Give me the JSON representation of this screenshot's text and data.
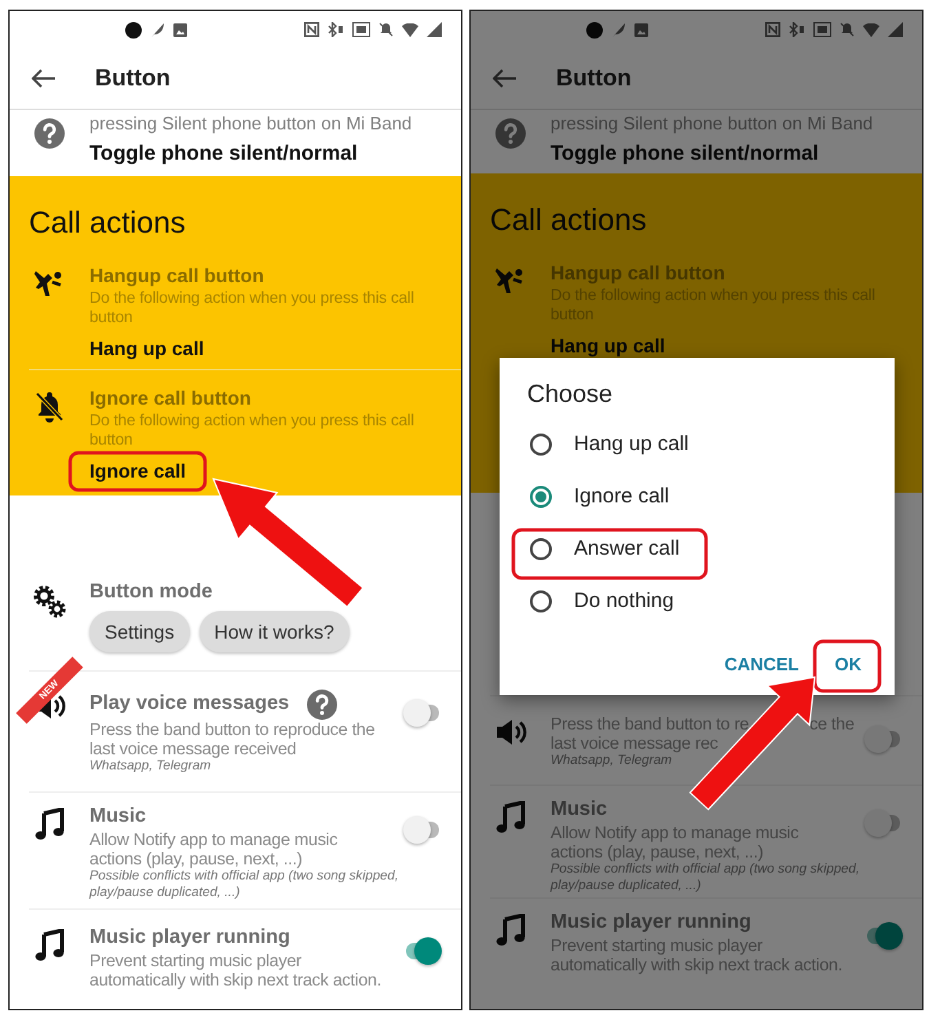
{
  "screens": [
    {
      "dimmed": false,
      "title": "Button",
      "items": [
        {
          "kind": "help_value",
          "description": "pressing Silent phone button on Mi Band",
          "value": "Toggle phone silent/normal"
        },
        {
          "kind": "section",
          "highlighted": true,
          "title": "Call actions",
          "items": [
            {
              "kind": "hangup",
              "title": "Hangup call button",
              "description": "Do the following action when you press this call button",
              "value": "Hang up call"
            },
            {
              "kind": "ignore",
              "title": "Ignore call button",
              "description": "Do the following action when you press this call button",
              "value": "Ignore call"
            }
          ]
        },
        {
          "kind": "mode",
          "title": "Button mode",
          "buttons": [
            "Settings",
            "How it works?"
          ]
        },
        {
          "kind": "voice",
          "badge": "NEW",
          "title": "Play voice messages",
          "description": "Press the band button to reproduce the last voice message received",
          "note": "Whatsapp, Telegram",
          "on": false
        },
        {
          "kind": "music",
          "title": "Music",
          "description": "Allow Notify app to manage music actions (play, pause, next, ...)",
          "note": "Possible conflicts with official app (two song skipped, play/pause duplicated, ...)",
          "on": false
        },
        {
          "kind": "music",
          "title": "Music player running",
          "description": "Prevent starting music player automatically with skip next track action.",
          "on": true
        }
      ]
    },
    {
      "dimmed": true,
      "title": "Button",
      "items": [
        {
          "kind": "help_value",
          "description": "pressing Silent phone button on Mi Band",
          "value": "Toggle phone silent/normal"
        },
        {
          "kind": "section",
          "highlighted": true,
          "title": "Call actions",
          "items": [
            {
              "kind": "hangup",
              "title": "Hangup call button",
              "description": "Do the following action when you press this call button",
              "value": "Hang up call"
            }
          ]
        },
        {
          "kind": "dialog",
          "title": "Choose",
          "options": [
            {
              "label": "Hang up call",
              "selected": false
            },
            {
              "label": "Ignore call",
              "selected": true
            },
            {
              "label": "Answer call",
              "selected": false
            },
            {
              "label": "Do nothing",
              "selected": false
            }
          ],
          "buttons": [
            "CANCEL",
            "OK"
          ]
        },
        {
          "kind": "voice",
          "description_lines": [
            [
              "Press the band button to re",
              "ce the"
            ],
            [
              "last voice message rec"
            ]
          ],
          "note": "Whatsapp, Telegram",
          "on": false
        },
        {
          "kind": "music",
          "title": "Music",
          "description": "Allow Notify app to manage music actions (play, pause, next, ...)",
          "note": "Possible conflicts with official app (two song skipped, play/pause duplicated, ...)",
          "on": false
        },
        {
          "kind": "music",
          "title": "Music player running",
          "description": "Prevent starting music player automatically with skip next track action.",
          "on": true
        }
      ]
    }
  ]
}
